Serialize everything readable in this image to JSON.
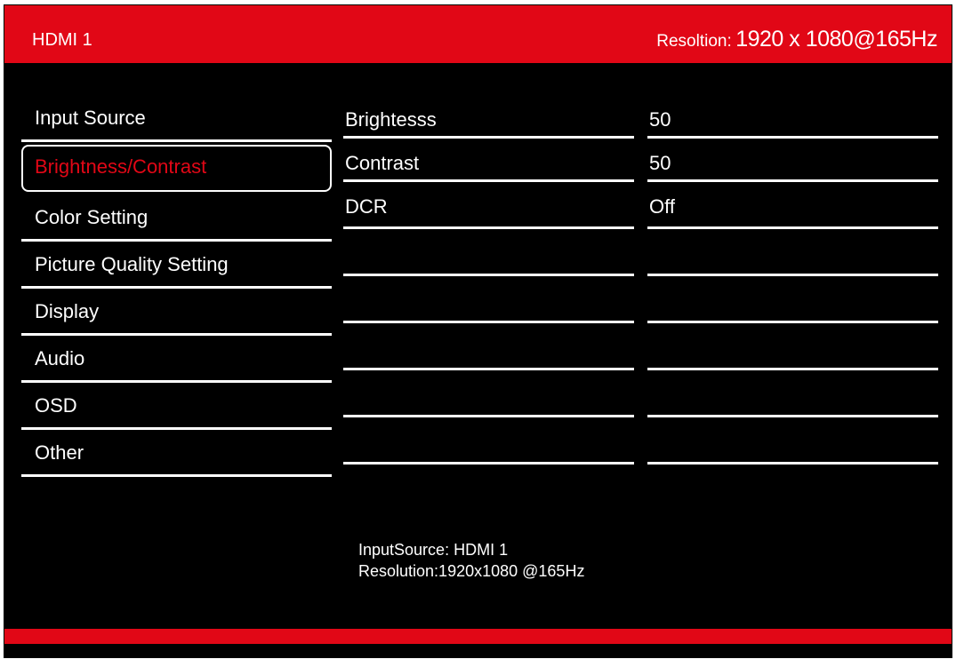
{
  "header": {
    "source_label": "HDMI 1",
    "resolution_label": "Resoltion:",
    "resolution_value": "1920 x 1080@165Hz"
  },
  "menu": [
    {
      "label": "Input Source",
      "selected": false
    },
    {
      "label": "Brightness/Contrast",
      "selected": true
    },
    {
      "label": "Color Setting",
      "selected": false
    },
    {
      "label": "Picture Quality Setting",
      "selected": false
    },
    {
      "label": "Display",
      "selected": false
    },
    {
      "label": "Audio",
      "selected": false
    },
    {
      "label": "OSD",
      "selected": false
    },
    {
      "label": "Other",
      "selected": false
    }
  ],
  "settings": [
    {
      "name": "Brightesss",
      "value": "50"
    },
    {
      "name": "Contrast",
      "value": "50"
    },
    {
      "name": "DCR",
      "value": "Off"
    }
  ],
  "footer": {
    "input_source_label": "InputSource:",
    "input_source_value": "HDMI 1",
    "resolution_line": "Resolution:1920x1080 @165Hz"
  },
  "colors": {
    "accent": "#e10716",
    "background": "#000000",
    "text": "#ffffff"
  }
}
